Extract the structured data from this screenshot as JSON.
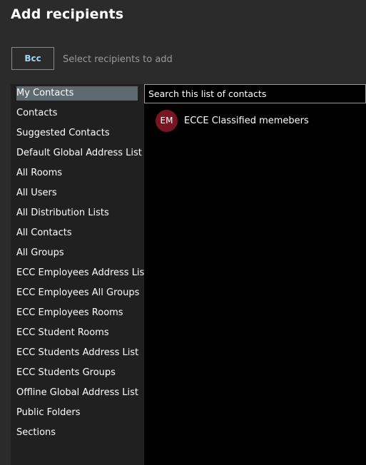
{
  "dialog": {
    "title": "Add recipients"
  },
  "recipient_field": {
    "type_label": "Bcc",
    "placeholder": "Select recipients to add"
  },
  "address_lists": {
    "selected": "My Contacts",
    "items": [
      "My Contacts",
      "Contacts",
      "Suggested Contacts",
      "Default Global Address List",
      "All Rooms",
      "All Users",
      "All Distribution Lists",
      "All Contacts",
      "All Groups",
      "ECC Employees Address List",
      "ECC Employees All Groups",
      "ECC Employees Rooms",
      "ECC Student Rooms",
      "ECC Students Address List",
      "ECC Students Groups",
      "Offline Global Address List",
      "Public Folders",
      "Sections"
    ]
  },
  "search": {
    "placeholder": "Search this list of contacts"
  },
  "contacts": [
    {
      "initials": "EM",
      "name": "ECCE Classified memebers",
      "avatar_color": "#7a1420"
    }
  ],
  "colors": {
    "background": "#2b2b2b",
    "left_panel": "#202020",
    "right_panel": "#000000",
    "selected_item": "#5d6a70",
    "bcc_text": "#9fd6f5"
  }
}
